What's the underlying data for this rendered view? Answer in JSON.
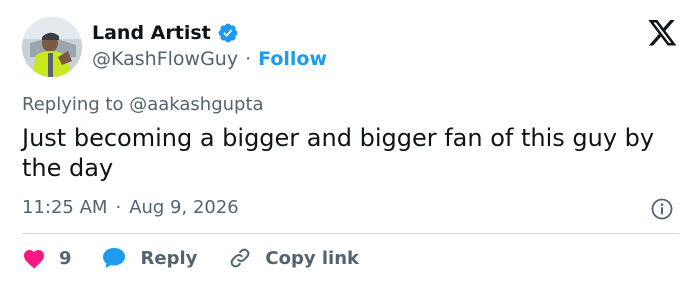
{
  "author": {
    "display_name": "Land Artist",
    "handle": "@KashFlowGuy",
    "separator": "·",
    "follow_label": "Follow"
  },
  "reply_context": {
    "prefix": "Replying to",
    "mention": "@aakashgupta"
  },
  "tweet": {
    "text": "Just becoming a bigger and bigger fan of this guy by the day"
  },
  "meta": {
    "time": "11:25 AM",
    "separator": "·",
    "date": "Aug 9, 2026"
  },
  "actions": {
    "like_count": "9",
    "reply_label": "Reply",
    "copy_link_label": "Copy link"
  },
  "icons": {
    "verified": "verified-badge-icon",
    "brand": "x-logo-icon",
    "info": "info-icon",
    "like": "heart-icon",
    "reply": "speech-bubble-icon",
    "copy_link": "link-icon"
  },
  "colors": {
    "accent": "#1d9bf0",
    "like": "#f91880",
    "text": "#0f1419",
    "muted": "#536471",
    "divider": "#cfd9de"
  }
}
